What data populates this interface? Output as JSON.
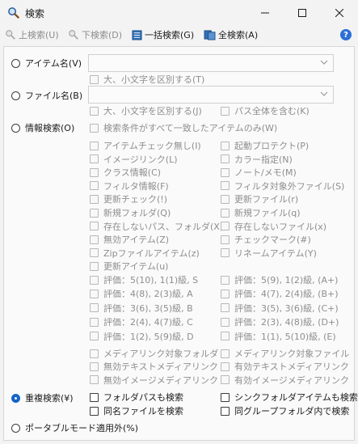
{
  "window": {
    "title": "検索",
    "icon": "search-icon"
  },
  "toolbar": {
    "prev_label": "上検索(U)",
    "next_label": "下検索(D)",
    "batch_label": "一括検索(G)",
    "all_label": "全検索(A)",
    "help_label": "?"
  },
  "search_modes": {
    "item_name": "アイテム名(V)",
    "file_name": "ファイル名(B)",
    "info_search": "情報検索(O)",
    "duplicate": "重複検索(¥)",
    "portable": "ポータブルモード適用外(%)"
  },
  "options": {
    "case_v": "大、小文字を区別する(T)",
    "case_b": "大、小文字を区別する(J)",
    "full_path": "パス全体を含む(K)",
    "all_match": "検索条件がすべて一致したアイテムのみ(W)"
  },
  "info_left": [
    "アイテムチェック無し(I)",
    "イメージリンク(L)",
    "クラス情報(C)",
    "フィルタ情報(F)",
    "更新チェック(!)",
    "新規フォルダ(Q)",
    "存在しないパス、フォルダ(X)",
    "無効アイテム(Z)",
    "Zipファイルアイテム(z)",
    "更新アイテム(u)"
  ],
  "info_right": [
    "起動プロテクト(P)",
    "カラー指定(N)",
    "ノート/メモ(M)",
    "フィルタ対象外ファイル(S)",
    "更新ファイル(r)",
    "新規ファイル(q)",
    "存在しないファイル(x)",
    "チェックマーク(#)",
    "リネームアイテム(Y)"
  ],
  "rating_left": [
    "評価：5(10), 1(1)級, S",
    "評価：4(8), 2(3)級, A",
    "評価：3(6), 3(5)級, B",
    "評価：2(4), 4(7)級, C",
    "評価：1(2), 5(9)級, D"
  ],
  "rating_right": [
    "評価：5(9), 1(2)級, (A+)",
    "評価：4(7), 2(4)級, (B+)",
    "評価：3(5), 3(6)級, (C+)",
    "評価：2(3), 4(8)級, (D+)",
    "評価：1(1), 5(10)級, (E)"
  ],
  "media_left": [
    "メディアリンク対象フォルダ",
    "無効テキストメディアリンク",
    "無効イメージメディアリンク"
  ],
  "media_right": [
    "メディアリンク対象ファイル",
    "有効テキストメディアリンク",
    "有効イメージメディアリンク"
  ],
  "duplicate_opts": {
    "folder_path": "フォルダパスも検索",
    "same_name": "同名ファイルを検索",
    "sync_folder": "シンクフォルダアイテムも検索",
    "same_group": "同グループフォルダ内で検索"
  },
  "colors": {
    "accent": "#1463c8",
    "disabled_text": "#8e8e8e",
    "background": "#f3f3f3"
  }
}
